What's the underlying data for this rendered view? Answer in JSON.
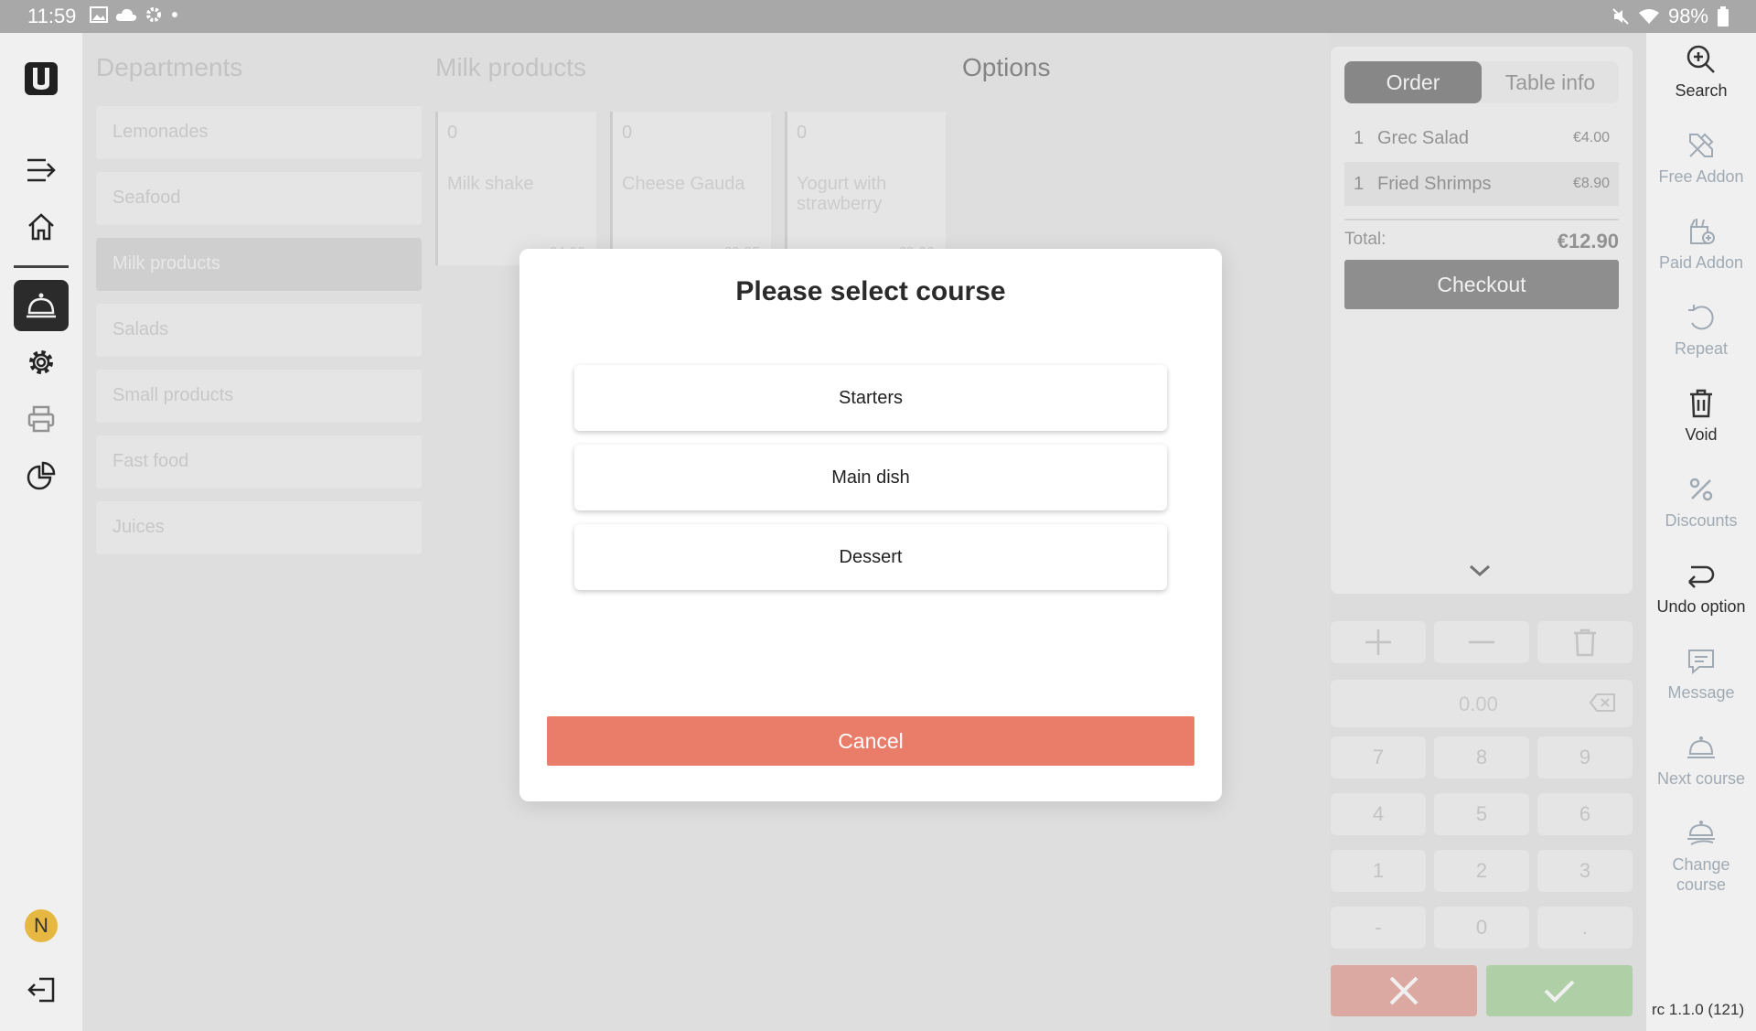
{
  "status_bar": {
    "time": "11:59",
    "battery": "98%"
  },
  "left_nav": {
    "avatar_initial": "N"
  },
  "main": {
    "departments_title": "Departments",
    "products_title": "Milk products",
    "options_title": "Options",
    "departments": [
      {
        "label": "Lemonades"
      },
      {
        "label": "Seafood"
      },
      {
        "label": "Milk products",
        "selected": true
      },
      {
        "label": "Salads"
      },
      {
        "label": "Small products"
      },
      {
        "label": "Fast food"
      },
      {
        "label": "Juices"
      }
    ],
    "products": [
      {
        "qty": "0",
        "name": "Milk shake",
        "price": "€4.90"
      },
      {
        "qty": "0",
        "name": "Cheese Gauda",
        "price": "€3.25"
      },
      {
        "qty": "0",
        "name": "Yogurt with strawberry",
        "price": "€3.00"
      }
    ]
  },
  "order_panel": {
    "tabs": [
      {
        "label": "Order"
      },
      {
        "label": "Table info"
      }
    ],
    "items": [
      {
        "qty": "1",
        "name": "Grec Salad",
        "price": "€4.00"
      },
      {
        "qty": "1",
        "name": "Fried Shrimps",
        "price": "€8.90"
      }
    ],
    "total_label": "Total:",
    "total_value": "€12.90",
    "checkout_label": "Checkout"
  },
  "keypad": {
    "display": "0.00",
    "keys": [
      "7",
      "8",
      "9",
      "4",
      "5",
      "6",
      "1",
      "2",
      "3",
      "-",
      "0",
      "."
    ]
  },
  "right_toolbar": {
    "buttons": [
      {
        "label": "Search",
        "icon": "search-icon"
      },
      {
        "label": "Free Addon",
        "icon": "tools-icon"
      },
      {
        "label": "Paid Addon",
        "icon": "paid-addon-icon"
      },
      {
        "label": "Repeat",
        "icon": "repeat-icon"
      },
      {
        "label": "Void",
        "icon": "trash-icon"
      },
      {
        "label": "Discounts",
        "icon": "percent-icon"
      },
      {
        "label": "Undo option",
        "icon": "undo-icon"
      },
      {
        "label": "Message",
        "icon": "message-icon"
      },
      {
        "label": "Next course",
        "icon": "cloche-icon"
      },
      {
        "label": "Change course",
        "icon": "change-course-icon"
      }
    ],
    "version": "rc 1.1.0 (121)"
  },
  "dialog": {
    "title": "Please select course",
    "options": [
      {
        "label": "Starters"
      },
      {
        "label": "Main dish"
      },
      {
        "label": "Dessert"
      }
    ],
    "cancel_label": "Cancel"
  },
  "colors": {
    "cancel": "#e97d69",
    "confirm": "#b9dcb0",
    "reject": "#eab2ab",
    "avatar": "#f5c342"
  }
}
